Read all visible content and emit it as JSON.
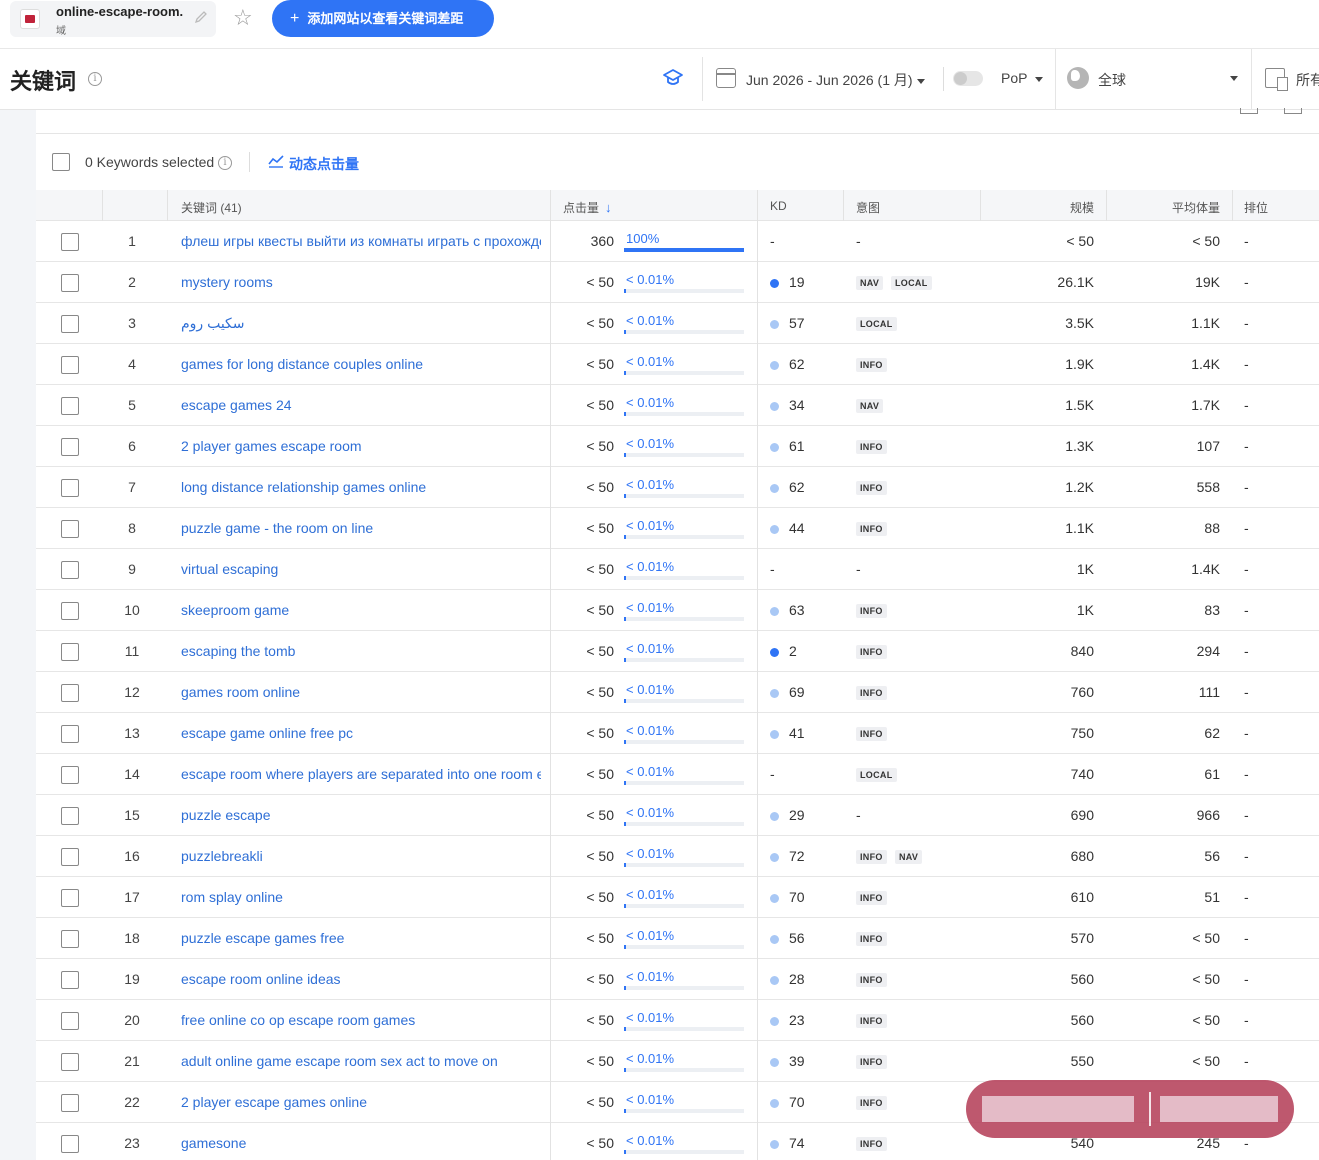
{
  "topbar": {
    "domain_name": "online-escape-room...",
    "domain_sub": "域",
    "add_button_label": "添加网站以查看关键词差距"
  },
  "header": {
    "title": "关键词",
    "date_range": "Jun 2026 - Jun 2026 (1 月)",
    "comparison": "PoP",
    "region": "全球",
    "device": "所有"
  },
  "toolbar": {
    "selected_text": "0 Keywords selected",
    "trend_label": "动态点击量"
  },
  "table": {
    "columns": {
      "keyword": "关键词 (41)",
      "clicks": "点击量",
      "kd": "KD",
      "intent": "意图",
      "volume": "规模",
      "avg_volume": "平均体量",
      "rank": "排位"
    },
    "rows": [
      {
        "n": "1",
        "kw": "флеш игры квесты выйти из комнаты играть с прохождением",
        "clicks": "360",
        "pct": "100%",
        "share": 100,
        "kd": "-",
        "kd_color": "",
        "intents": [],
        "vol": "< 50",
        "avg": "< 50",
        "rank": "-"
      },
      {
        "n": "2",
        "kw": "mystery rooms",
        "clicks": "< 50",
        "pct": "< 0.01%",
        "share": 0.5,
        "kd": "19",
        "kd_color": "#2f74f5",
        "intents": [
          "NAV",
          "LOCAL"
        ],
        "vol": "26.1K",
        "avg": "19K",
        "rank": "-"
      },
      {
        "n": "3",
        "kw": "سكيب روم",
        "clicks": "< 50",
        "pct": "< 0.01%",
        "share": 0.5,
        "kd": "57",
        "kd_color": "#a9c8f5",
        "intents": [
          "LOCAL"
        ],
        "vol": "3.5K",
        "avg": "1.1K",
        "rank": "-"
      },
      {
        "n": "4",
        "kw": "games for long distance couples online",
        "clicks": "< 50",
        "pct": "< 0.01%",
        "share": 0.5,
        "kd": "62",
        "kd_color": "#a9c8f5",
        "intents": [
          "INFO"
        ],
        "vol": "1.9K",
        "avg": "1.4K",
        "rank": "-"
      },
      {
        "n": "5",
        "kw": "escape games 24",
        "clicks": "< 50",
        "pct": "< 0.01%",
        "share": 0.5,
        "kd": "34",
        "kd_color": "#a9c8f5",
        "intents": [
          "NAV"
        ],
        "vol": "1.5K",
        "avg": "1.7K",
        "rank": "-"
      },
      {
        "n": "6",
        "kw": "2 player games escape room",
        "clicks": "< 50",
        "pct": "< 0.01%",
        "share": 0.5,
        "kd": "61",
        "kd_color": "#a9c8f5",
        "intents": [
          "INFO"
        ],
        "vol": "1.3K",
        "avg": "107",
        "rank": "-"
      },
      {
        "n": "7",
        "kw": "long distance relationship games online",
        "clicks": "< 50",
        "pct": "< 0.01%",
        "share": 0.5,
        "kd": "62",
        "kd_color": "#a9c8f5",
        "intents": [
          "INFO"
        ],
        "vol": "1.2K",
        "avg": "558",
        "rank": "-"
      },
      {
        "n": "8",
        "kw": "puzzle game - the room on line",
        "clicks": "< 50",
        "pct": "< 0.01%",
        "share": 0.5,
        "kd": "44",
        "kd_color": "#a9c8f5",
        "intents": [
          "INFO"
        ],
        "vol": "1.1K",
        "avg": "88",
        "rank": "-"
      },
      {
        "n": "9",
        "kw": "virtual escaping",
        "clicks": "< 50",
        "pct": "< 0.01%",
        "share": 0.5,
        "kd": "-",
        "kd_color": "",
        "intents": [],
        "vol": "1K",
        "avg": "1.4K",
        "rank": "-"
      },
      {
        "n": "10",
        "kw": "skeeproom game",
        "clicks": "< 50",
        "pct": "< 0.01%",
        "share": 0.5,
        "kd": "63",
        "kd_color": "#a9c8f5",
        "intents": [
          "INFO"
        ],
        "vol": "1K",
        "avg": "83",
        "rank": "-"
      },
      {
        "n": "11",
        "kw": "escaping the tomb",
        "clicks": "< 50",
        "pct": "< 0.01%",
        "share": 0.5,
        "kd": "2",
        "kd_color": "#2f74f5",
        "intents": [
          "INFO"
        ],
        "vol": "840",
        "avg": "294",
        "rank": "-"
      },
      {
        "n": "12",
        "kw": "games room online",
        "clicks": "< 50",
        "pct": "< 0.01%",
        "share": 0.5,
        "kd": "69",
        "kd_color": "#a9c8f5",
        "intents": [
          "INFO"
        ],
        "vol": "760",
        "avg": "111",
        "rank": "-"
      },
      {
        "n": "13",
        "kw": "escape game online free pc",
        "clicks": "< 50",
        "pct": "< 0.01%",
        "share": 0.5,
        "kd": "41",
        "kd_color": "#a9c8f5",
        "intents": [
          "INFO"
        ],
        "vol": "750",
        "avg": "62",
        "rank": "-"
      },
      {
        "n": "14",
        "kw": "escape room where players are separated into one room each",
        "clicks": "< 50",
        "pct": "< 0.01%",
        "share": 0.5,
        "kd": "-",
        "kd_color": "",
        "intents": [
          "LOCAL"
        ],
        "vol": "740",
        "avg": "61",
        "rank": "-"
      },
      {
        "n": "15",
        "kw": "puzzle escape",
        "clicks": "< 50",
        "pct": "< 0.01%",
        "share": 0.5,
        "kd": "29",
        "kd_color": "#a9c8f5",
        "intents": [],
        "vol": "690",
        "avg": "966",
        "rank": "-"
      },
      {
        "n": "16",
        "kw": "puzzlebreakli",
        "clicks": "< 50",
        "pct": "< 0.01%",
        "share": 0.5,
        "kd": "72",
        "kd_color": "#a9c8f5",
        "intents": [
          "INFO",
          "NAV"
        ],
        "vol": "680",
        "avg": "56",
        "rank": "-"
      },
      {
        "n": "17",
        "kw": "rom splay online",
        "clicks": "< 50",
        "pct": "< 0.01%",
        "share": 0.5,
        "kd": "70",
        "kd_color": "#a9c8f5",
        "intents": [
          "INFO"
        ],
        "vol": "610",
        "avg": "51",
        "rank": "-"
      },
      {
        "n": "18",
        "kw": "puzzle escape games free",
        "clicks": "< 50",
        "pct": "< 0.01%",
        "share": 0.5,
        "kd": "56",
        "kd_color": "#a9c8f5",
        "intents": [
          "INFO"
        ],
        "vol": "570",
        "avg": "< 50",
        "rank": "-"
      },
      {
        "n": "19",
        "kw": "escape room online ideas",
        "clicks": "< 50",
        "pct": "< 0.01%",
        "share": 0.5,
        "kd": "28",
        "kd_color": "#a9c8f5",
        "intents": [
          "INFO"
        ],
        "vol": "560",
        "avg": "< 50",
        "rank": "-"
      },
      {
        "n": "20",
        "kw": "free online co op escape room games",
        "clicks": "< 50",
        "pct": "< 0.01%",
        "share": 0.5,
        "kd": "23",
        "kd_color": "#a9c8f5",
        "intents": [
          "INFO"
        ],
        "vol": "560",
        "avg": "< 50",
        "rank": "-"
      },
      {
        "n": "21",
        "kw": "adult online game escape room sex act to move on",
        "clicks": "< 50",
        "pct": "< 0.01%",
        "share": 0.5,
        "kd": "39",
        "kd_color": "#a9c8f5",
        "intents": [
          "INFO"
        ],
        "vol": "550",
        "avg": "< 50",
        "rank": "-"
      },
      {
        "n": "22",
        "kw": "2 player escape games online",
        "clicks": "< 50",
        "pct": "< 0.01%",
        "share": 0.5,
        "kd": "70",
        "kd_color": "#a9c8f5",
        "intents": [
          "INFO"
        ],
        "vol": "",
        "avg": "",
        "rank": ""
      },
      {
        "n": "23",
        "kw": "gamesone",
        "clicks": "< 50",
        "pct": "< 0.01%",
        "share": 0.5,
        "kd": "74",
        "kd_color": "#a9c8f5",
        "intents": [
          "INFO"
        ],
        "vol": "540",
        "avg": "245",
        "rank": "-"
      }
    ]
  }
}
